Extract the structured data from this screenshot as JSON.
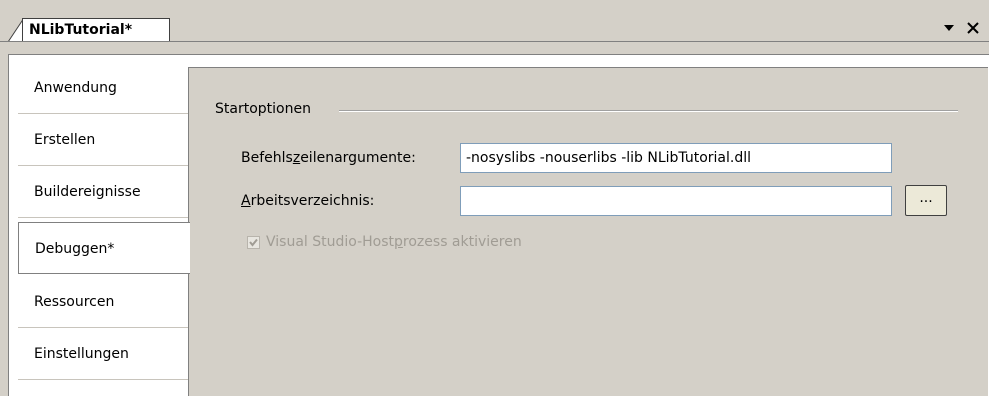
{
  "document_tab": {
    "title": "NLibTutorial*",
    "controls": {
      "dropdown_icon": "chevron-down-icon",
      "close_icon": "close-icon"
    }
  },
  "sidebar": {
    "items": [
      {
        "label": "Anwendung",
        "selected": false
      },
      {
        "label": "Erstellen",
        "selected": false
      },
      {
        "label": "Buildereignisse",
        "selected": false
      },
      {
        "label": "Debuggen*",
        "selected": true
      },
      {
        "label": "Ressourcen",
        "selected": false
      },
      {
        "label": "Einstellungen",
        "selected": false
      }
    ]
  },
  "startoptions": {
    "group_title": "Startoptionen",
    "command_args": {
      "label_pre": "Befehls",
      "label_accel": "z",
      "label_post": "eilenargumente:",
      "value": "-nosyslibs -nouserlibs -lib NLibTutorial.dll"
    },
    "working_dir": {
      "label_accel": "A",
      "label_post": "rbeitsverzeichnis:",
      "value": "",
      "browse_label": "..."
    },
    "hostprocess": {
      "label_pre": "Visual Studio-Host",
      "label_accel": "p",
      "label_post": "rozess aktivieren",
      "checked": true,
      "enabled": false
    }
  }
}
